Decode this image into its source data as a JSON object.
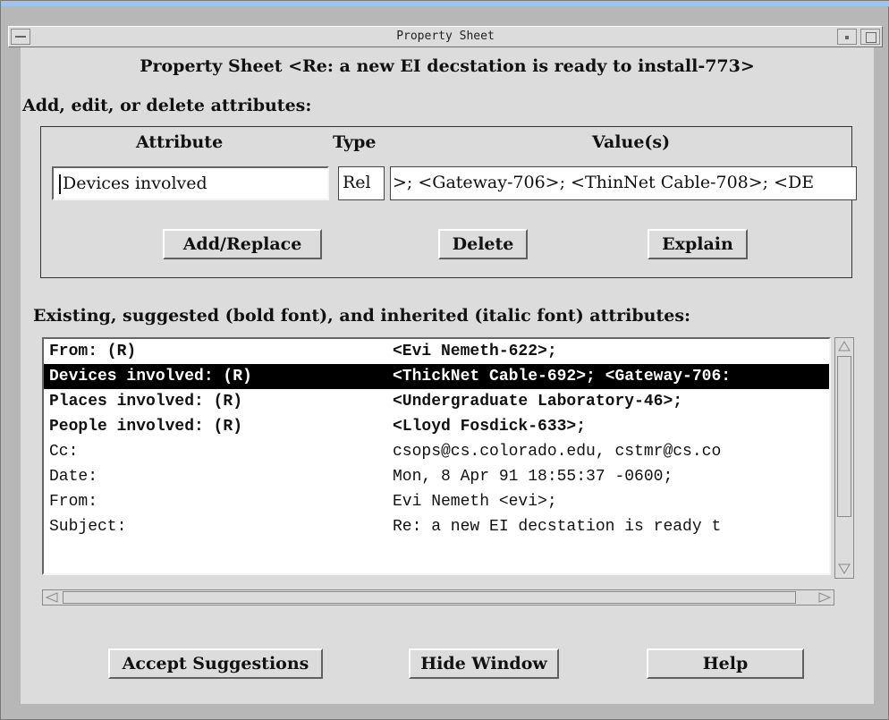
{
  "window": {
    "title": "Property Sheet"
  },
  "header": {
    "title": "Property Sheet <Re: a new EI decstation is ready to install-773>"
  },
  "edit_section": {
    "label": "Add, edit, or delete attributes:",
    "col_attribute": "Attribute",
    "col_type": "Type",
    "col_values": "Value(s)",
    "attribute_value": "Devices involved",
    "type_value": "Rel",
    "values_value": ">; <Gateway-706>; <ThinNet Cable-708>; <DE",
    "add_replace_label": "Add/Replace",
    "delete_label": "Delete",
    "explain_label": "Explain"
  },
  "existing_section": {
    "label": "Existing, suggested (bold font), and inherited (italic font) attributes:",
    "rows": [
      {
        "name": "From: (R)",
        "value": "<Evi Nemeth-622>;",
        "style": "bold"
      },
      {
        "name": "Devices involved: (R)",
        "value": "<ThickNet Cable-692>; <Gateway-706:",
        "style": "selected"
      },
      {
        "name": "Places involved: (R)",
        "value": "<Undergraduate Laboratory-46>;",
        "style": "bold"
      },
      {
        "name": "People involved: (R)",
        "value": "<Lloyd Fosdick-633>;",
        "style": "bold"
      },
      {
        "name": "Cc:",
        "value": "csops@cs.colorado.edu, cstmr@cs.co",
        "style": "normal"
      },
      {
        "name": "Date:",
        "value": "Mon, 8 Apr 91 18:55:37 -0600;",
        "style": "normal"
      },
      {
        "name": "From:",
        "value": "Evi Nemeth <evi>;",
        "style": "normal"
      },
      {
        "name": "Subject:",
        "value": "Re: a new EI decstation is ready t",
        "style": "normal"
      }
    ]
  },
  "footer": {
    "accept_label": "Accept Suggestions",
    "hide_label": "Hide Window",
    "help_label": "Help"
  }
}
